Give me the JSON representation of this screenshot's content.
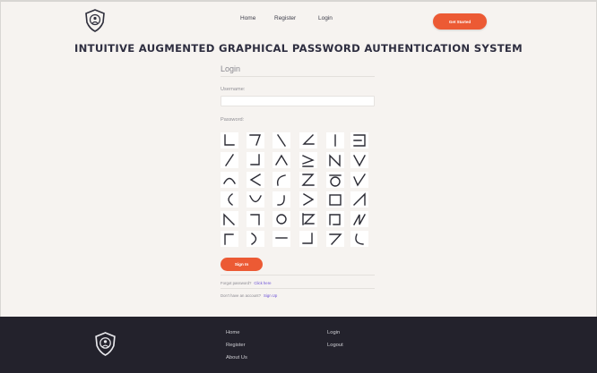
{
  "nav": {
    "links": [
      "Home",
      "Register",
      "Login"
    ],
    "cta_label": "Get Started"
  },
  "page_title": "INTUITIVE AUGMENTED GRAPHICAL PASSWORD AUTHENTICATION SYSTEM",
  "login": {
    "heading": "Login",
    "username_label": "Username:",
    "username_value": "",
    "password_label": "Password:",
    "signin_label": "Sign In",
    "forgot_text": "Forgot password?",
    "forgot_link": "Click here",
    "signup_text": "Don't have an account?",
    "signup_link": "Sign Up"
  },
  "password_symbols": [
    [
      "corner-bottom-left",
      "slanted-corner",
      "backslash",
      "z-angle",
      "vertical-bar",
      "square-bracket"
    ],
    [
      "slash",
      "corner-bottom-right",
      "caret-up",
      "greater-equal",
      "letter-n",
      "letter-v"
    ],
    [
      "arch",
      "less-than",
      "c-arc",
      "letter-z",
      "circle-dash",
      "check-v"
    ],
    [
      "left-paren",
      "cup",
      "dot-cup",
      "greater-than",
      "square",
      "slant-corner"
    ],
    [
      "diagonal-corner",
      "corner-top-right",
      "circle",
      "z-box",
      "box-corner",
      "letter-n-reverse"
    ],
    [
      "corner-top-left",
      "right-paren",
      "dash",
      "corner-bottom-right-small",
      "seven",
      "hook"
    ]
  ],
  "footer": {
    "col1": [
      "Home",
      "Register",
      "About Us"
    ],
    "col2": [
      "Login",
      "Logout"
    ]
  },
  "colors": {
    "accent": "#ec5a34",
    "background": "#f6f3f0",
    "footer": "#23222c",
    "link": "#6a4fd6"
  }
}
